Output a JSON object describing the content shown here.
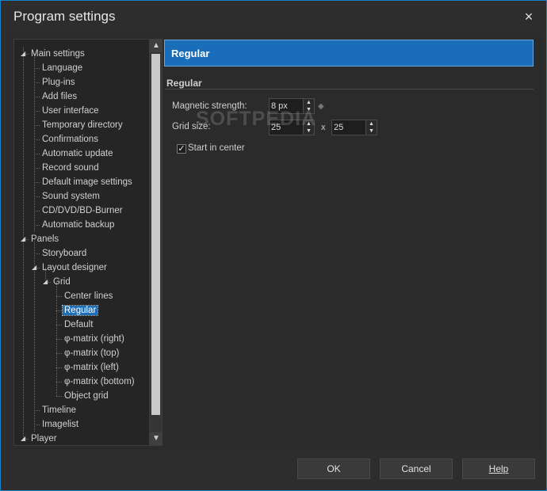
{
  "window": {
    "title": "Program settings",
    "close_glyph": "×"
  },
  "tree": {
    "items": [
      {
        "label": "Main settings",
        "expanded": true
      },
      {
        "label": "Language"
      },
      {
        "label": "Plug-ins"
      },
      {
        "label": "Add files"
      },
      {
        "label": "User interface"
      },
      {
        "label": "Temporary directory"
      },
      {
        "label": "Confirmations"
      },
      {
        "label": "Automatic update"
      },
      {
        "label": "Record sound"
      },
      {
        "label": "Default image settings"
      },
      {
        "label": "Sound system"
      },
      {
        "label": "CD/DVD/BD-Burner"
      },
      {
        "label": "Automatic backup"
      },
      {
        "label": "Panels",
        "expanded": true
      },
      {
        "label": "Storyboard"
      },
      {
        "label": "Layout designer",
        "expanded": true
      },
      {
        "label": "Grid",
        "expanded": true
      },
      {
        "label": "Center lines"
      },
      {
        "label": "Regular",
        "selected": true
      },
      {
        "label": "Default"
      },
      {
        "label": "φ-matrix (right)"
      },
      {
        "label": "φ-matrix (top)"
      },
      {
        "label": "φ-matrix (left)"
      },
      {
        "label": "φ-matrix (bottom)"
      },
      {
        "label": "Object grid"
      },
      {
        "label": "Timeline"
      },
      {
        "label": "Imagelist"
      },
      {
        "label": "Player",
        "expanded": true
      }
    ],
    "scroll_up_glyph": "▲",
    "scroll_down_glyph": "▼",
    "expander_glyph": "◢"
  },
  "panel": {
    "header": "Regular",
    "section": "Regular",
    "magnetic_strength": {
      "label": "Magnetic strength:",
      "value": "8 px"
    },
    "grid_size": {
      "label": "Grid size:",
      "width": "25",
      "separator": "x",
      "height": "25"
    },
    "start_in_center": {
      "label": "Start in center",
      "checked": true,
      "check_glyph": "✓"
    },
    "spin_up_glyph": "▲",
    "spin_down_glyph": "▼",
    "link_glyph": "◆"
  },
  "watermark": "SOFTPEDIA",
  "buttons": {
    "ok": "OK",
    "cancel": "Cancel",
    "help": "Help"
  },
  "colors": {
    "accent": "#1a6db8",
    "selection": "#1c6fb8",
    "window_border": "#1584c6"
  },
  "icons": [
    "close-icon",
    "tree-expander-icon",
    "scroll-up-icon",
    "scroll-down-icon",
    "spin-up-icon",
    "spin-down-icon",
    "checkmark-icon",
    "link-icon"
  ]
}
